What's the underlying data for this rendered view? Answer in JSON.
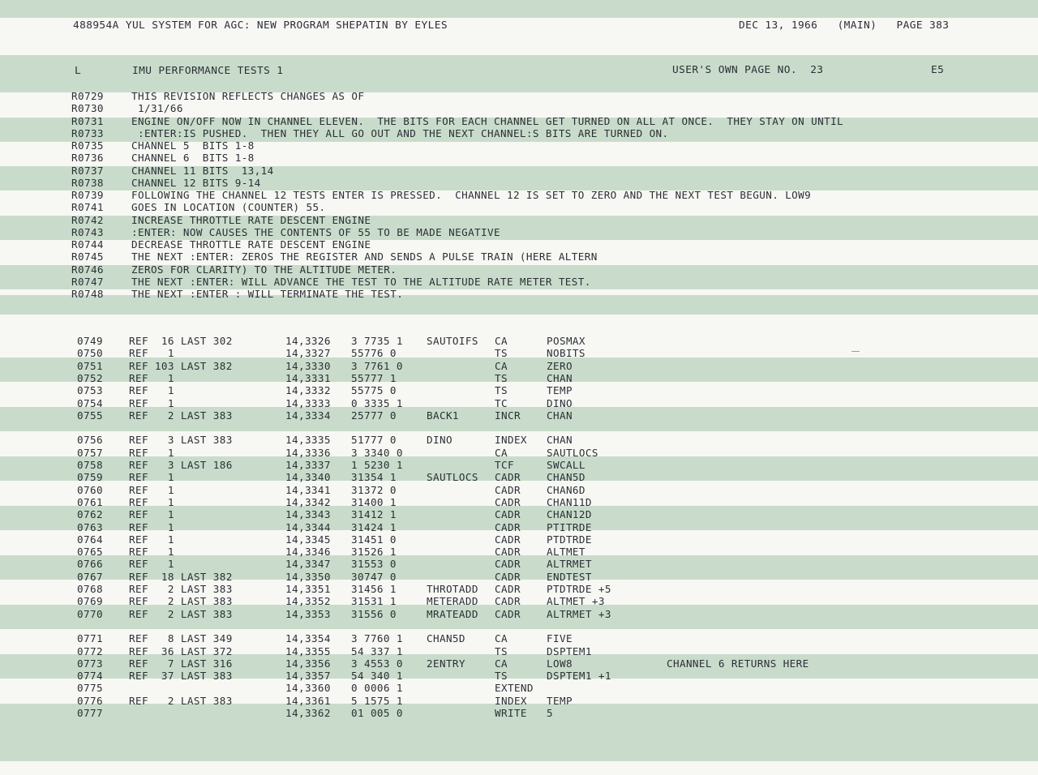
{
  "header": {
    "job": "488954A YUL SYSTEM FOR AGC: NEW PROGRAM SHEPATIN BY EYLES",
    "date_page": "DEC 13, 1966   (MAIN)   PAGE 383"
  },
  "subheader": {
    "code": "L",
    "title": "IMU PERFORMANCE TESTS 1",
    "user_page": "USER'S OWN PAGE NO.  23",
    "col": "E5"
  },
  "revisions": [
    {
      "num": "R0729",
      "text": "THIS REVISION REFLECTS CHANGES AS OF"
    },
    {
      "num": "R0730",
      "text": " 1/31/66"
    },
    {
      "num": "R0731",
      "text": "ENGINE ON/OFF NOW IN CHANNEL ELEVEN.  THE BITS FOR EACH CHANNEL GET TURNED ON ALL AT ONCE.  THEY STAY ON UNTIL"
    },
    {
      "num": "R0733",
      "text": " :ENTER:IS PUSHED.  THEN THEY ALL GO OUT AND THE NEXT CHANNEL:S BITS ARE TURNED ON."
    },
    {
      "num": "R0735",
      "text": "CHANNEL 5  BITS 1-8"
    },
    {
      "num": "R0736",
      "text": "CHANNEL 6  BITS 1-8"
    },
    {
      "num": "R0737",
      "text": "CHANNEL 11 BITS  13,14"
    },
    {
      "num": "R0738",
      "text": "CHANNEL 12 BITS 9-14"
    },
    {
      "num": "R0739",
      "text": "FOLLOWING THE CHANNEL 12 TESTS ENTER IS PRESSED.  CHANNEL 12 IS SET TO ZERO AND THE NEXT TEST BEGUN. LOW9"
    },
    {
      "num": "R0741",
      "text": "GOES IN LOCATION (COUNTER) 55."
    },
    {
      "num": "R0742",
      "text": "INCREASE THROTTLE RATE DESCENT ENGINE"
    },
    {
      "num": "R0743",
      "text": ":ENTER: NOW CAUSES THE CONTENTS OF 55 TO BE MADE NEGATIVE"
    },
    {
      "num": "R0744",
      "text": "DECREASE THROTTLE RATE DESCENT ENGINE"
    },
    {
      "num": "R0745",
      "text": "THE NEXT :ENTER: ZEROS THE REGISTER AND SENDS A PULSE TRAIN (HERE ALTERN"
    },
    {
      "num": "R0746",
      "text": "ZEROS FOR CLARITY) TO THE ALTITUDE METER."
    },
    {
      "num": "R0747",
      "text": "THE NEXT :ENTER: WILL ADVANCE THE TEST TO THE ALTITUDE RATE METER TEST."
    },
    {
      "num": "R0748",
      "text": "THE NEXT :ENTER : WILL TERMINATE THE TEST."
    }
  ],
  "code_lines": [
    {
      "num": "0749",
      "ref": "REF  16 LAST 302",
      "addr": "14,3326",
      "word": "3 7735 1",
      "label": "SAUTOIFS",
      "op": "CA",
      "operand": "POSMAX",
      "comment": ""
    },
    {
      "num": "0750",
      "ref": "REF   1",
      "addr": "14,3327",
      "word": "55776 0",
      "label": "",
      "op": "TS",
      "operand": "NOBITS",
      "comment": ""
    },
    {
      "num": "0751",
      "ref": "REF 103 LAST 382",
      "addr": "14,3330",
      "word": "3 7761 0",
      "label": "",
      "op": "CA",
      "operand": "ZERO",
      "comment": ""
    },
    {
      "num": "0752",
      "ref": "REF   1",
      "addr": "14,3331",
      "word": "55777 1",
      "label": "",
      "op": "TS",
      "operand": "CHAN",
      "comment": ""
    },
    {
      "num": "0753",
      "ref": "REF   1",
      "addr": "14,3332",
      "word": "55775 0",
      "label": "",
      "op": "TS",
      "operand": "TEMP",
      "comment": ""
    },
    {
      "num": "0754",
      "ref": "REF   1",
      "addr": "14,3333",
      "word": "0 3335 1",
      "label": "",
      "op": "TC",
      "operand": "DINO",
      "comment": ""
    },
    {
      "num": "0755",
      "ref": "REF   2 LAST 383",
      "addr": "14,3334",
      "word": "25777 0",
      "label": "BACK1",
      "op": "INCR",
      "operand": "CHAN",
      "comment": ""
    },
    {
      "num": "0756",
      "ref": "REF   3 LAST 383",
      "addr": "14,3335",
      "word": "51777 0",
      "label": "DINO",
      "op": "INDEX",
      "operand": "CHAN",
      "comment": ""
    },
    {
      "num": "0757",
      "ref": "REF   1",
      "addr": "14,3336",
      "word": "3 3340 0",
      "label": "",
      "op": "CA",
      "operand": "SAUTLOCS",
      "comment": ""
    },
    {
      "num": "0758",
      "ref": "REF   3 LAST 186",
      "addr": "14,3337",
      "word": "1 5230 1",
      "label": "",
      "op": "TCF",
      "operand": "SWCALL",
      "comment": ""
    },
    {
      "num": "0759",
      "ref": "REF   1",
      "addr": "14,3340",
      "word": "31354 1",
      "label": "SAUTLOCS",
      "op": "CADR",
      "operand": "CHAN5D",
      "comment": ""
    },
    {
      "num": "0760",
      "ref": "REF   1",
      "addr": "14,3341",
      "word": "31372 0",
      "label": "",
      "op": "CADR",
      "operand": "CHAN6D",
      "comment": ""
    },
    {
      "num": "0761",
      "ref": "REF   1",
      "addr": "14,3342",
      "word": "31400 1",
      "label": "",
      "op": "CADR",
      "operand": "CHAN11D",
      "comment": ""
    },
    {
      "num": "0762",
      "ref": "REF   1",
      "addr": "14,3343",
      "word": "31412 1",
      "label": "",
      "op": "CADR",
      "operand": "CHAN12D",
      "comment": ""
    },
    {
      "num": "0763",
      "ref": "REF   1",
      "addr": "14,3344",
      "word": "31424 1",
      "label": "",
      "op": "CADR",
      "operand": "PTITRDE",
      "comment": ""
    },
    {
      "num": "0764",
      "ref": "REF   1",
      "addr": "14,3345",
      "word": "31451 0",
      "label": "",
      "op": "CADR",
      "operand": "PTDTRDE",
      "comment": ""
    },
    {
      "num": "0765",
      "ref": "REF   1",
      "addr": "14,3346",
      "word": "31526 1",
      "label": "",
      "op": "CADR",
      "operand": "ALTMET",
      "comment": ""
    },
    {
      "num": "0766",
      "ref": "REF   1",
      "addr": "14,3347",
      "word": "31553 0",
      "label": "",
      "op": "CADR",
      "operand": "ALTRMET",
      "comment": ""
    },
    {
      "num": "0767",
      "ref": "REF  18 LAST 382",
      "addr": "14,3350",
      "word": "30747 0",
      "label": "",
      "op": "CADR",
      "operand": "ENDTEST",
      "comment": ""
    },
    {
      "num": "0768",
      "ref": "REF   2 LAST 383",
      "addr": "14,3351",
      "word": "31456 1",
      "label": "THROTADD",
      "op": "CADR",
      "operand": "PTDTRDE +5",
      "comment": ""
    },
    {
      "num": "0769",
      "ref": "REF   2 LAST 383",
      "addr": "14,3352",
      "word": "31531 1",
      "label": "METERADD",
      "op": "CADR",
      "operand": "ALTMET +3",
      "comment": ""
    },
    {
      "num": "0770",
      "ref": "REF   2 LAST 383",
      "addr": "14,3353",
      "word": "31556 0",
      "label": "MRATEADD",
      "op": "CADR",
      "operand": "ALTRMET +3",
      "comment": ""
    },
    {
      "num": "0771",
      "ref": "REF   8 LAST 349",
      "addr": "14,3354",
      "word": "3 7760 1",
      "label": "CHAN5D",
      "op": "CA",
      "operand": "FIVE",
      "comment": ""
    },
    {
      "num": "0772",
      "ref": "REF  36 LAST 372",
      "addr": "14,3355",
      "word": "54 337 1",
      "label": "",
      "op": "TS",
      "operand": "DSPTEM1",
      "comment": ""
    },
    {
      "num": "0773",
      "ref": "REF   7 LAST 316",
      "addr": "14,3356",
      "word": "3 4553 0",
      "label": "2ENTRY",
      "op": "CA",
      "operand": "LOW8",
      "comment": "CHANNEL 6 RETURNS HERE"
    },
    {
      "num": "0774",
      "ref": "REF  37 LAST 383",
      "addr": "14,3357",
      "word": "54 340 1",
      "label": "",
      "op": "TS",
      "operand": "DSPTEM1 +1",
      "comment": ""
    },
    {
      "num": "0775",
      "ref": "",
      "addr": "14,3360",
      "word": "0 0006 1",
      "label": "",
      "op": "EXTEND",
      "operand": "",
      "comment": ""
    },
    {
      "num": "0776",
      "ref": "REF   2 LAST 383",
      "addr": "14,3361",
      "word": "5 1575 1",
      "label": "",
      "op": "INDEX",
      "operand": "TEMP",
      "comment": ""
    },
    {
      "num": "0777",
      "ref": "",
      "addr": "14,3362",
      "word": "01 005 0",
      "label": "",
      "op": "WRITE",
      "operand": "5",
      "comment": ""
    }
  ]
}
